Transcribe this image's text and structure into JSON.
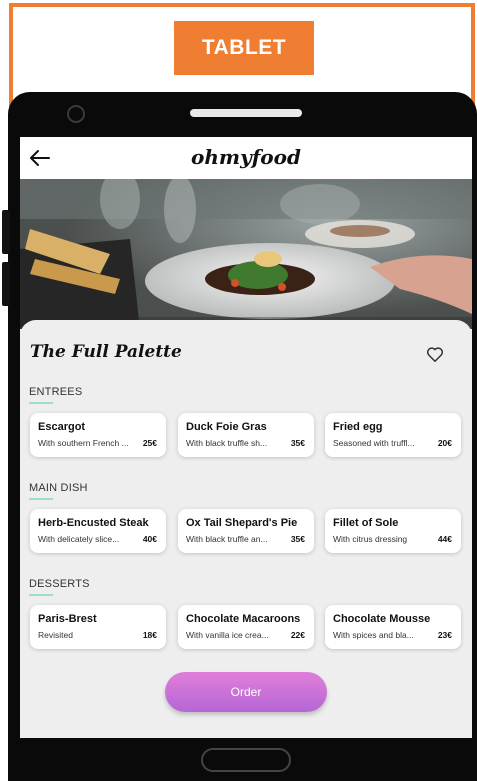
{
  "frame": {
    "label": "TABLET",
    "accent": "#ef7d32"
  },
  "app": {
    "brand": "ohmyfood"
  },
  "restaurant": {
    "name": "The Full Palette"
  },
  "sections": [
    {
      "label": "ENTREES",
      "items": [
        {
          "name": "Escargot",
          "description": "With southern French ...",
          "price": "25€"
        },
        {
          "name": "Duck Foie Gras",
          "description": "With black truffle sh...",
          "price": "35€"
        },
        {
          "name": "Fried egg",
          "description": "Seasoned with truffl...",
          "price": "20€"
        }
      ]
    },
    {
      "label": "MAIN DISH",
      "items": [
        {
          "name": "Herb-Encusted Steak",
          "description": "With delicately slice...",
          "price": "40€"
        },
        {
          "name": "Ox Tail Shepard's Pie",
          "description": "With black truffle an...",
          "price": "35€"
        },
        {
          "name": "Fillet of Sole",
          "description": "With citrus dressing",
          "price": "44€"
        }
      ]
    },
    {
      "label": "DESSERTS",
      "items": [
        {
          "name": "Paris-Brest",
          "description": "Revisited",
          "price": "18€"
        },
        {
          "name": "Chocolate Macaroons",
          "description": "With vanilla ice crea...",
          "price": "22€"
        },
        {
          "name": "Chocolate Mousse",
          "description": "With spices and bla...",
          "price": "23€"
        }
      ]
    }
  ],
  "order": {
    "label": "Order"
  },
  "colors": {
    "underline": "#99e3c4",
    "order_gradient_start": "#e07fd9",
    "order_gradient_end": "#b566d6"
  },
  "icons": {
    "back": "arrow-left-icon",
    "favorite": "heart-outline-icon"
  }
}
